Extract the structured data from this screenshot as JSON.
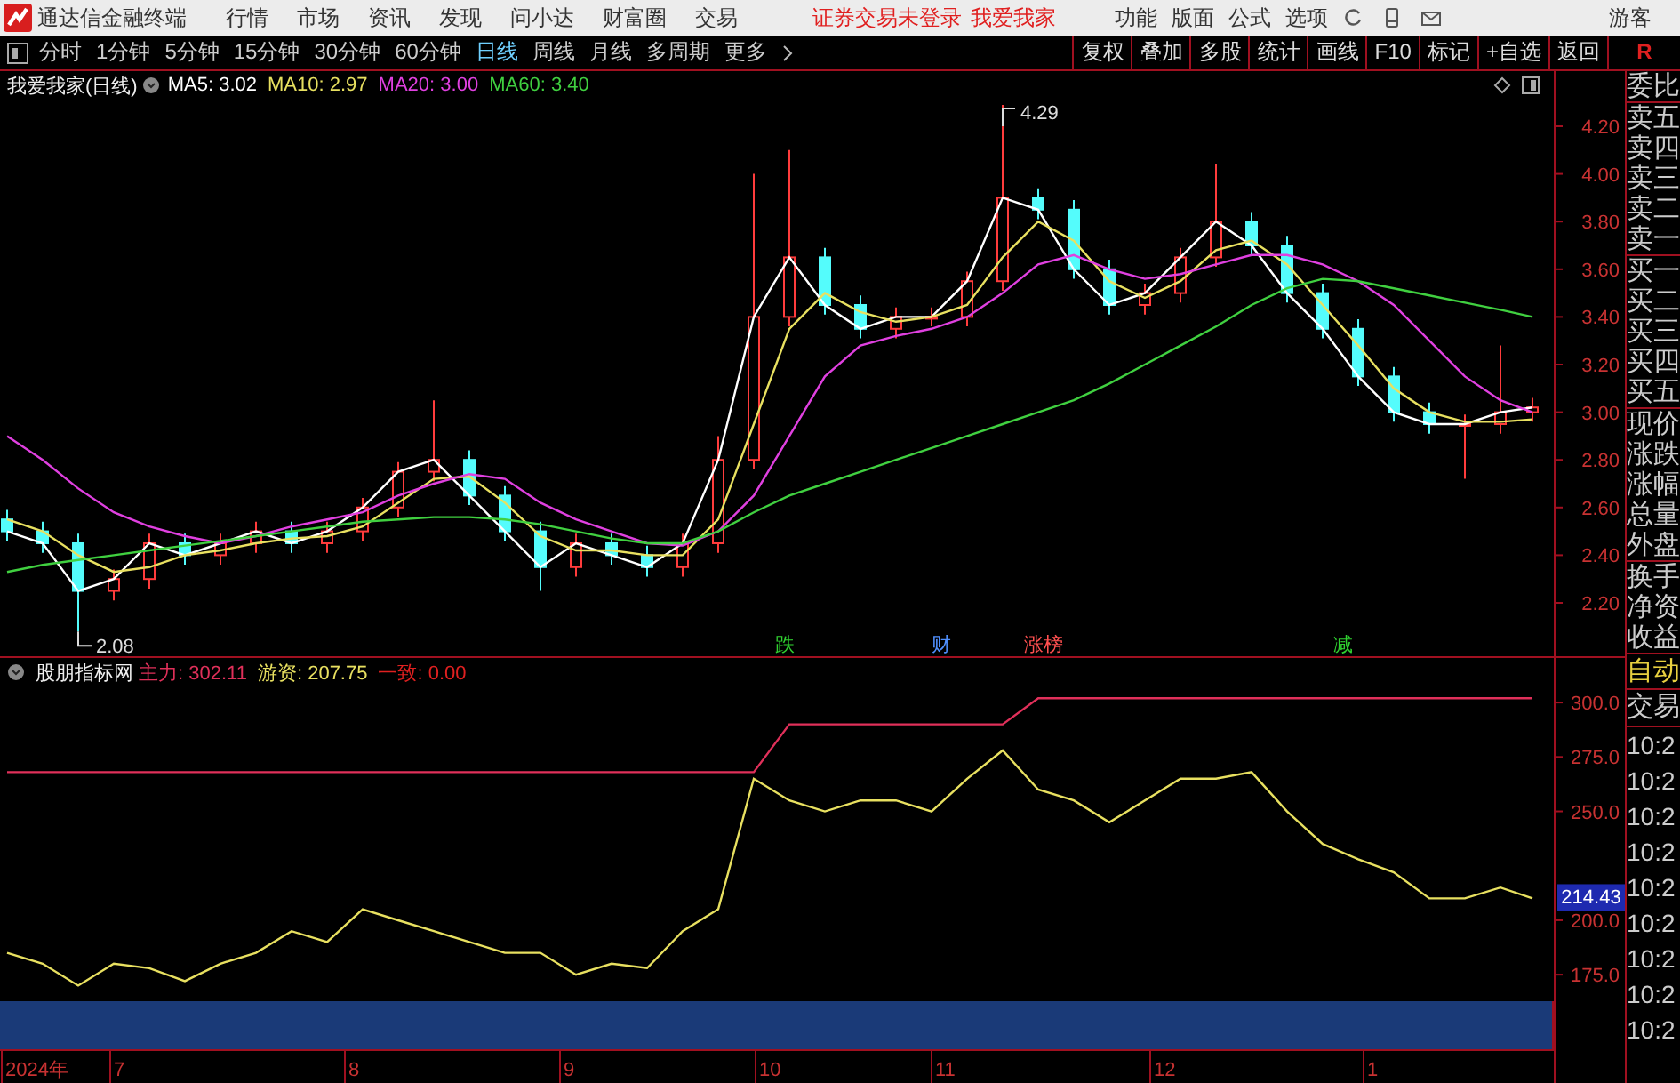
{
  "app_bar": {
    "app_name": "通达信金融终端",
    "menus": [
      "行情",
      "市场",
      "资讯",
      "发现",
      "问小达",
      "财富圈",
      "交易"
    ],
    "notices": [
      "证券交易未登录",
      "我爱我家"
    ],
    "tools": [
      "功能",
      "版面",
      "公式",
      "选项"
    ],
    "user": "游客"
  },
  "toolbar": {
    "periods": [
      {
        "label": "分时",
        "selected": false
      },
      {
        "label": "1分钟",
        "selected": false
      },
      {
        "label": "5分钟",
        "selected": false
      },
      {
        "label": "15分钟",
        "selected": false
      },
      {
        "label": "30分钟",
        "selected": false
      },
      {
        "label": "60分钟",
        "selected": false
      },
      {
        "label": "日线",
        "selected": true
      },
      {
        "label": "周线",
        "selected": false
      },
      {
        "label": "月线",
        "selected": false
      },
      {
        "label": "多周期",
        "selected": false
      }
    ],
    "more": "更多",
    "actions": [
      "复权",
      "叠加",
      "多股",
      "统计",
      "画线",
      "F10",
      "标记",
      "+自选",
      "返回"
    ],
    "right_label": "R"
  },
  "price_panel": {
    "title": "我爱我家(日线)",
    "legend_separator": ": ",
    "legend_values": [
      "3.02",
      "2.97",
      "3.00",
      "3.40"
    ],
    "chart_data": {
      "type": "candlestick",
      "ylim": [
        1.976,
        4.312
      ],
      "ohlc": [
        [
          2.55,
          2.59,
          2.46,
          2.5
        ],
        [
          2.5,
          2.54,
          2.41,
          2.45
        ],
        [
          2.45,
          2.49,
          2.08,
          2.25
        ],
        [
          2.25,
          2.34,
          2.21,
          2.3
        ],
        [
          2.3,
          2.49,
          2.26,
          2.45
        ],
        [
          2.45,
          2.49,
          2.36,
          2.4
        ],
        [
          2.4,
          2.49,
          2.36,
          2.45
        ],
        [
          2.45,
          2.54,
          2.41,
          2.5
        ],
        [
          2.5,
          2.54,
          2.41,
          2.45
        ],
        [
          2.45,
          2.54,
          2.41,
          2.5
        ],
        [
          2.5,
          2.64,
          2.46,
          2.6
        ],
        [
          2.6,
          2.79,
          2.56,
          2.75
        ],
        [
          2.75,
          3.05,
          2.71,
          2.8
        ],
        [
          2.8,
          2.84,
          2.61,
          2.65
        ],
        [
          2.65,
          2.69,
          2.46,
          2.5
        ],
        [
          2.5,
          2.54,
          2.25,
          2.35
        ],
        [
          2.35,
          2.49,
          2.31,
          2.45
        ],
        [
          2.45,
          2.49,
          2.36,
          2.4
        ],
        [
          2.4,
          2.44,
          2.31,
          2.35
        ],
        [
          2.35,
          2.49,
          2.31,
          2.45
        ],
        [
          2.45,
          2.9,
          2.41,
          2.8
        ],
        [
          2.8,
          4.0,
          2.76,
          3.4
        ],
        [
          3.4,
          4.1,
          3.36,
          3.65
        ],
        [
          3.65,
          3.69,
          3.41,
          3.45
        ],
        [
          3.45,
          3.49,
          3.31,
          3.35
        ],
        [
          3.35,
          3.44,
          3.31,
          3.4
        ],
        [
          3.4,
          3.44,
          3.36,
          3.4
        ],
        [
          3.4,
          3.59,
          3.36,
          3.55
        ],
        [
          3.55,
          4.29,
          3.51,
          3.9
        ],
        [
          3.9,
          3.94,
          3.81,
          3.85
        ],
        [
          3.85,
          3.89,
          3.56,
          3.6
        ],
        [
          3.6,
          3.64,
          3.41,
          3.45
        ],
        [
          3.45,
          3.54,
          3.41,
          3.5
        ],
        [
          3.5,
          3.69,
          3.46,
          3.65
        ],
        [
          3.65,
          4.04,
          3.61,
          3.8
        ],
        [
          3.8,
          3.84,
          3.66,
          3.7
        ],
        [
          3.7,
          3.74,
          3.46,
          3.5
        ],
        [
          3.5,
          3.54,
          3.31,
          3.35
        ],
        [
          3.35,
          3.39,
          3.11,
          3.15
        ],
        [
          3.15,
          3.19,
          2.96,
          3.0
        ],
        [
          3.0,
          3.04,
          2.91,
          2.95
        ],
        [
          2.95,
          2.99,
          2.72,
          2.95
        ],
        [
          2.95,
          3.28,
          2.91,
          3.0
        ],
        [
          3.0,
          3.06,
          2.96,
          3.02
        ]
      ],
      "annotations": [
        "4.29",
        "2.08"
      ]
    },
    "ma_overlay": {
      "chart_data": {
        "type": "line",
        "ylim": [
          2.2,
          4.2
        ],
        "yticks": [
          {
            "value": 4.2,
            "label": "4.20"
          },
          {
            "value": 4.0,
            "label": "4.00"
          },
          {
            "value": 3.8,
            "label": "3.80"
          },
          {
            "value": 3.6,
            "label": "3.60"
          },
          {
            "value": 3.4,
            "label": "3.40"
          },
          {
            "value": 3.2,
            "label": "3.20"
          },
          {
            "value": 3.0,
            "label": "3.00"
          },
          {
            "value": 2.8,
            "label": "2.80"
          },
          {
            "value": 2.6,
            "label": "2.60"
          },
          {
            "value": 2.4,
            "label": "2.40"
          },
          {
            "value": 2.2,
            "label": "2.20"
          }
        ],
        "series": [
          {
            "name": "MA5",
            "color": "#ffffff",
            "values": [
              2.5,
              2.45,
              2.25,
              2.3,
              2.45,
              2.4,
              2.45,
              2.5,
              2.45,
              2.5,
              2.6,
              2.75,
              2.8,
              2.65,
              2.5,
              2.35,
              2.45,
              2.4,
              2.35,
              2.45,
              2.8,
              3.4,
              3.65,
              3.45,
              3.35,
              3.4,
              3.4,
              3.55,
              3.9,
              3.85,
              3.6,
              3.45,
              3.5,
              3.65,
              3.8,
              3.7,
              3.5,
              3.35,
              3.15,
              3.0,
              2.95,
              2.95,
              3.0,
              3.02
            ]
          },
          {
            "name": "MA10",
            "color": "#e8e060",
            "values": [
              2.55,
              2.5,
              2.4,
              2.33,
              2.35,
              2.4,
              2.42,
              2.45,
              2.47,
              2.48,
              2.52,
              2.62,
              2.72,
              2.73,
              2.62,
              2.48,
              2.42,
              2.42,
              2.4,
              2.4,
              2.55,
              2.95,
              3.35,
              3.5,
              3.42,
              3.38,
              3.4,
              3.45,
              3.65,
              3.8,
              3.72,
              3.55,
              3.48,
              3.55,
              3.68,
              3.72,
              3.62,
              3.45,
              3.28,
              3.1,
              3.0,
              2.96,
              2.96,
              2.97
            ]
          },
          {
            "name": "MA20",
            "color": "#e040e0",
            "values": [
              2.9,
              2.8,
              2.68,
              2.58,
              2.52,
              2.48,
              2.45,
              2.48,
              2.52,
              2.55,
              2.58,
              2.65,
              2.7,
              2.74,
              2.72,
              2.62,
              2.55,
              2.5,
              2.45,
              2.44,
              2.5,
              2.65,
              2.9,
              3.15,
              3.28,
              3.32,
              3.35,
              3.4,
              3.5,
              3.62,
              3.66,
              3.6,
              3.56,
              3.58,
              3.62,
              3.66,
              3.66,
              3.62,
              3.55,
              3.45,
              3.3,
              3.15,
              3.05,
              3.0
            ]
          },
          {
            "name": "MA60",
            "color": "#40d040",
            "values": [
              2.33,
              2.36,
              2.38,
              2.4,
              2.42,
              2.44,
              2.46,
              2.48,
              2.5,
              2.52,
              2.54,
              2.55,
              2.56,
              2.56,
              2.55,
              2.53,
              2.5,
              2.47,
              2.45,
              2.45,
              2.5,
              2.58,
              2.65,
              2.7,
              2.75,
              2.8,
              2.85,
              2.9,
              2.95,
              3.0,
              3.05,
              3.12,
              3.2,
              3.28,
              3.36,
              3.45,
              3.52,
              3.56,
              3.55,
              3.52,
              3.49,
              3.46,
              3.43,
              3.4
            ]
          }
        ]
      }
    },
    "events": [
      {
        "text": "跌",
        "color": "#30d030"
      },
      {
        "text": "财",
        "color": "#5090ff"
      },
      {
        "text": "涨榜",
        "color": "#ff5050"
      },
      {
        "text": "减",
        "color": "#30d030"
      }
    ]
  },
  "indicator_panel": {
    "title": "股朋指标网",
    "legend_separator": ": ",
    "legend_values": [
      "302.11",
      "207.75"
    ],
    "extra_legend": {
      "name": "一致",
      "value": "0.00",
      "color": "#e02020"
    },
    "current_value": "214.43",
    "chart_data": {
      "type": "line",
      "ylim": [
        162.8,
        307.4
      ],
      "yticks": [
        {
          "value": 300,
          "label": "300.0"
        },
        {
          "value": 275,
          "label": "275.0"
        },
        {
          "value": 250,
          "label": "250.0"
        },
        {
          "value": 200,
          "label": "200.0"
        },
        {
          "value": 175,
          "label": "175.0"
        }
      ],
      "series": [
        {
          "name": "主力",
          "color": "#e0305a",
          "values": [
            268,
            268,
            268,
            268,
            268,
            268,
            268,
            268,
            268,
            268,
            268,
            268,
            268,
            268,
            268,
            268,
            268,
            268,
            268,
            268,
            268,
            268,
            290,
            290,
            290,
            290,
            290,
            290,
            290,
            302,
            302,
            302,
            302,
            302,
            302,
            302,
            302,
            302,
            302,
            302,
            302,
            302,
            302,
            302
          ]
        },
        {
          "name": "游资",
          "color": "#e8e060",
          "values": [
            185,
            180,
            170,
            180,
            178,
            172,
            180,
            185,
            195,
            190,
            205,
            200,
            195,
            190,
            185,
            185,
            175,
            180,
            178,
            195,
            205,
            265,
            255,
            250,
            255,
            255,
            250,
            265,
            278,
            260,
            255,
            245,
            255,
            265,
            265,
            268,
            250,
            235,
            228,
            222,
            210,
            210,
            215,
            210
          ]
        }
      ]
    }
  },
  "date_axis": [
    "2024年",
    "7",
    "8",
    "9",
    "10",
    "11",
    "12",
    "1"
  ],
  "quote_panel": {
    "groups": [
      {
        "items": [
          "委比"
        ]
      },
      {
        "items": [
          "卖五",
          "卖四",
          "卖三",
          "卖二",
          "卖一"
        ]
      },
      {
        "items": [
          "买一",
          "买二",
          "买三",
          "买四",
          "买五"
        ]
      },
      {
        "items": [
          "现价",
          "涨跌",
          "涨幅",
          "总量",
          "外盘"
        ]
      },
      {
        "items": [
          "换手",
          "净资",
          "收益"
        ]
      }
    ]
  },
  "trade_panel": {
    "mode": "自动",
    "title": "交易",
    "times": [
      "10:2",
      "10:2",
      "10:2",
      "10:2",
      "10:2",
      "10:2",
      "10:2",
      "10:2",
      "10:2"
    ]
  }
}
